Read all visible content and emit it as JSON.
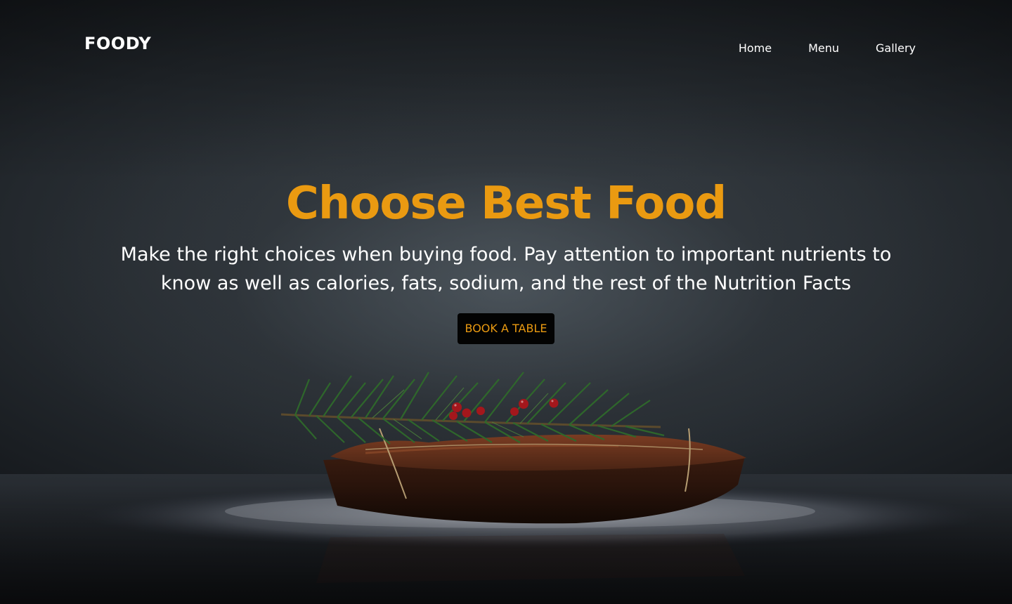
{
  "brand": {
    "name": "FOODY"
  },
  "nav": {
    "items": [
      {
        "label": "Home"
      },
      {
        "label": "Menu"
      },
      {
        "label": "Gallery"
      }
    ]
  },
  "hero": {
    "title": "Choose Best Food",
    "subtitle": "Make the right choices when buying food. Pay attention to important nutrients to know as well as calories, fats, sodium, and the rest of the Nutrition Facts",
    "cta_label": "BOOK A TABLE",
    "image": "dark food photo of a brownie slice tied with twine and topped with a pine sprig and red berries, dusted with sugar"
  },
  "colors": {
    "accent": "#ea9a11",
    "text": "#ffffff",
    "button_bg": "#030303",
    "background": "#23282d"
  }
}
